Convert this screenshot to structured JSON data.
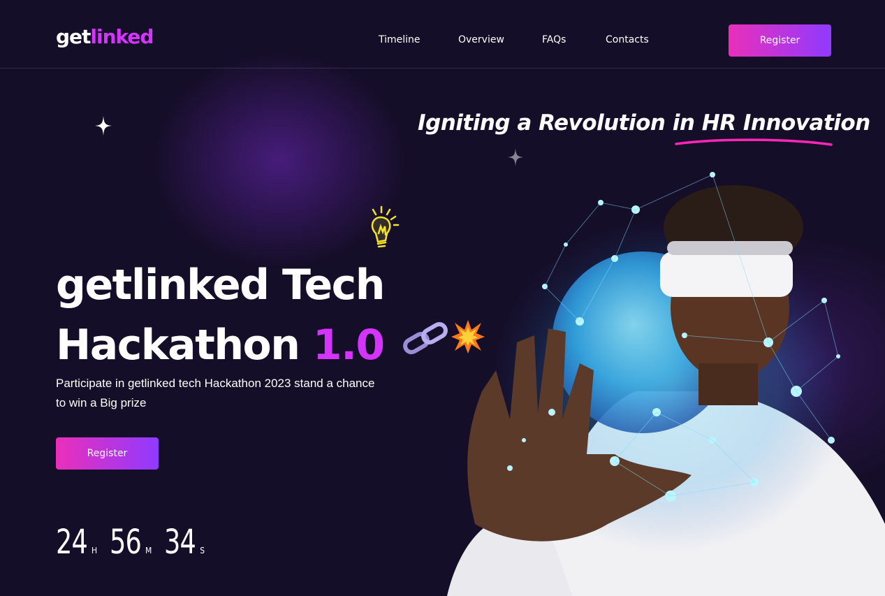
{
  "header": {
    "logo_part1": "get",
    "logo_part2": "linked",
    "nav": [
      "Timeline",
      "Overview",
      "FAQs",
      "Contacts"
    ],
    "register_label": "Register"
  },
  "hero": {
    "tagline": "Igniting a Revolution in HR Innovation",
    "headline_line1": "getlinked Tech",
    "headline_line2": "Hackathon ",
    "headline_accent": "1.0",
    "subtitle": "Participate in getlinked tech Hackathon 2023 stand a chance to win a Big prize",
    "register_label": "Register",
    "countdown": {
      "hours": "24",
      "hours_unit": "H",
      "minutes": "56",
      "minutes_unit": "M",
      "seconds": "34",
      "seconds_unit": "S"
    }
  },
  "colors": {
    "background": "#150e28",
    "accent": "#d434fe",
    "button_start": "#ea2fba",
    "button_end": "#903aff"
  },
  "icons": [
    "sparkle-icon",
    "lightbulb-icon",
    "chain-link-icon",
    "explosion-icon"
  ]
}
